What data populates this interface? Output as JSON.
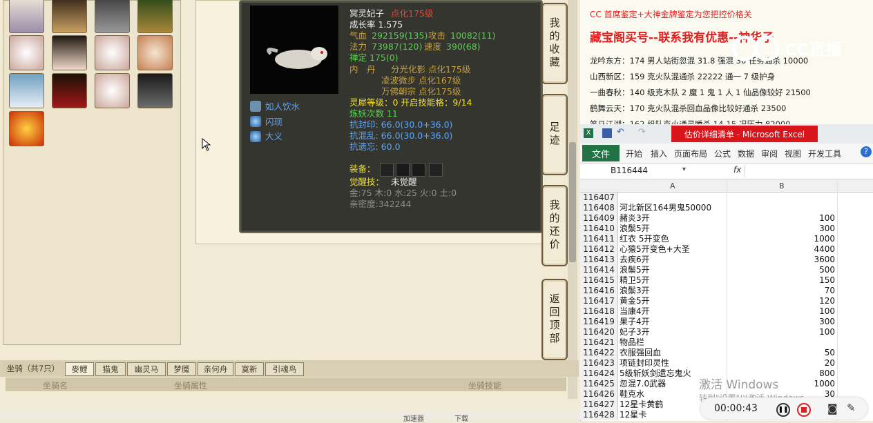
{
  "pet": {
    "name": "冥灵妃子",
    "level": "点化175级",
    "growth": "成长率 1.575",
    "hp_label": "气血",
    "hp": "292159(135)",
    "atk_label": "攻击",
    "atk": "10082(11)",
    "mp_label": "法力",
    "mp": "73987(120)",
    "spd_label": "速度",
    "spd": "390(68)",
    "zen": "禅定 175(0)",
    "neidan_label": "内　丹",
    "neidan": [
      "分光化影 点化175级",
      "凌波微步 点化167级",
      "万佛朝宗 点化175级"
    ],
    "lingxi": "灵犀等级：0 开启技能格：9/14",
    "lianyao": "炼妖次数 11",
    "resist_seal": "抗封印: 66.0(30.0+36.0)",
    "resist_chaos": "抗混乱: 66.0(30.0+36.0)",
    "resist_forget": "抗遗忘: 60.0",
    "equip_label": "装备：",
    "awaken_label": "觉醒技：",
    "awaken_value": "未觉醒",
    "elements": "金:75 木:0 水:25 火:0 土:0",
    "intimacy": "亲密度:342244",
    "skills": [
      "如人饮水",
      "闪现",
      "大义"
    ]
  },
  "side_buttons": [
    "我的收藏",
    "足迹",
    "我的还价",
    "返回顶部"
  ],
  "mount_tabs": [
    "坐骑（共7只）",
    "麥鲤",
    "猫鬼",
    "幽灵马",
    "梦魇",
    "亲何舟",
    "寞新",
    "引魂鸟"
  ],
  "mount_columns": [
    "坐骑名",
    "坐骑属性",
    "坐骑技能"
  ],
  "statusbar": [
    "加速器",
    "下载"
  ],
  "doc": {
    "line_top": "CC 首席鉴定+大神金牌鉴定为您把控价格关",
    "headline": "藏宝阁买号--联系我有优惠--神华子",
    "lines": [
      "龙吟东方：174 男人站街忽混 31.8 强混 30 任务通杀 10000",
      "山西新区：159 克火队混通杀 22222 通一 7 级护身",
      "一曲春秋：140 级克木队 2 魔 1 鬼 1 人 1 仙品像较好 21500",
      "鹤舞云天：170 克火队混杀回血品像比较好通杀 23500",
      "笑马江湖：162 组队克火通灵睡杀 14-15 况压力 82000"
    ]
  },
  "excel": {
    "title": "估价详细清单 - Microsoft Excel",
    "file_tab": "文件",
    "ribbon": [
      "开始",
      "插入",
      "页面布局",
      "公式",
      "数据",
      "审阅",
      "视图",
      "开发工具"
    ],
    "cell_ref": "B116444",
    "fx": "fx",
    "col_a": "A",
    "col_b": "B",
    "rows": [
      {
        "n": "116407",
        "a": "",
        "b": ""
      },
      {
        "n": "116408",
        "a": "河北新区164男鬼50000",
        "b": ""
      },
      {
        "n": "116409",
        "a": "赭炎3开",
        "b": "100"
      },
      {
        "n": "116410",
        "a": "浪鬃5开",
        "b": "300"
      },
      {
        "n": "116411",
        "a": "红衣 5开变色",
        "b": "1000"
      },
      {
        "n": "116412",
        "a": "心猿5开变色+大圣",
        "b": "4400"
      },
      {
        "n": "116413",
        "a": "去疾6开",
        "b": "3600"
      },
      {
        "n": "116414",
        "a": "浪鬃5开",
        "b": "500"
      },
      {
        "n": "116415",
        "a": "精卫5开",
        "b": "150"
      },
      {
        "n": "116416",
        "a": "浪鬃3开",
        "b": "70"
      },
      {
        "n": "116417",
        "a": "黄金5开",
        "b": "120"
      },
      {
        "n": "116418",
        "a": "当康4开",
        "b": "100"
      },
      {
        "n": "116419",
        "a": "果子4开",
        "b": "300"
      },
      {
        "n": "116420",
        "a": "妃子3开",
        "b": "100"
      },
      {
        "n": "116421",
        "a": "物品栏",
        "b": ""
      },
      {
        "n": "116422",
        "a": "衣服强回血",
        "b": "50"
      },
      {
        "n": "116423",
        "a": "项链封印灵性",
        "b": "20"
      },
      {
        "n": "116424",
        "a": "5级斩妖剑遗忘鬼火",
        "b": "800"
      },
      {
        "n": "116425",
        "a": "忽混7.0武器",
        "b": "1000"
      },
      {
        "n": "116426",
        "a": "鞋克水",
        "b": "30"
      },
      {
        "n": "116427",
        "a": "12星卡黄鹤",
        "b": ""
      },
      {
        "n": "116428",
        "a": "12星卡",
        "b": ""
      }
    ]
  },
  "watermark": {
    "line1": "激活 Windows",
    "line2": "转到\"设置\"以激活 Windows。"
  },
  "recorder": {
    "time": "00:00:43"
  },
  "logo_text": "CC直播"
}
